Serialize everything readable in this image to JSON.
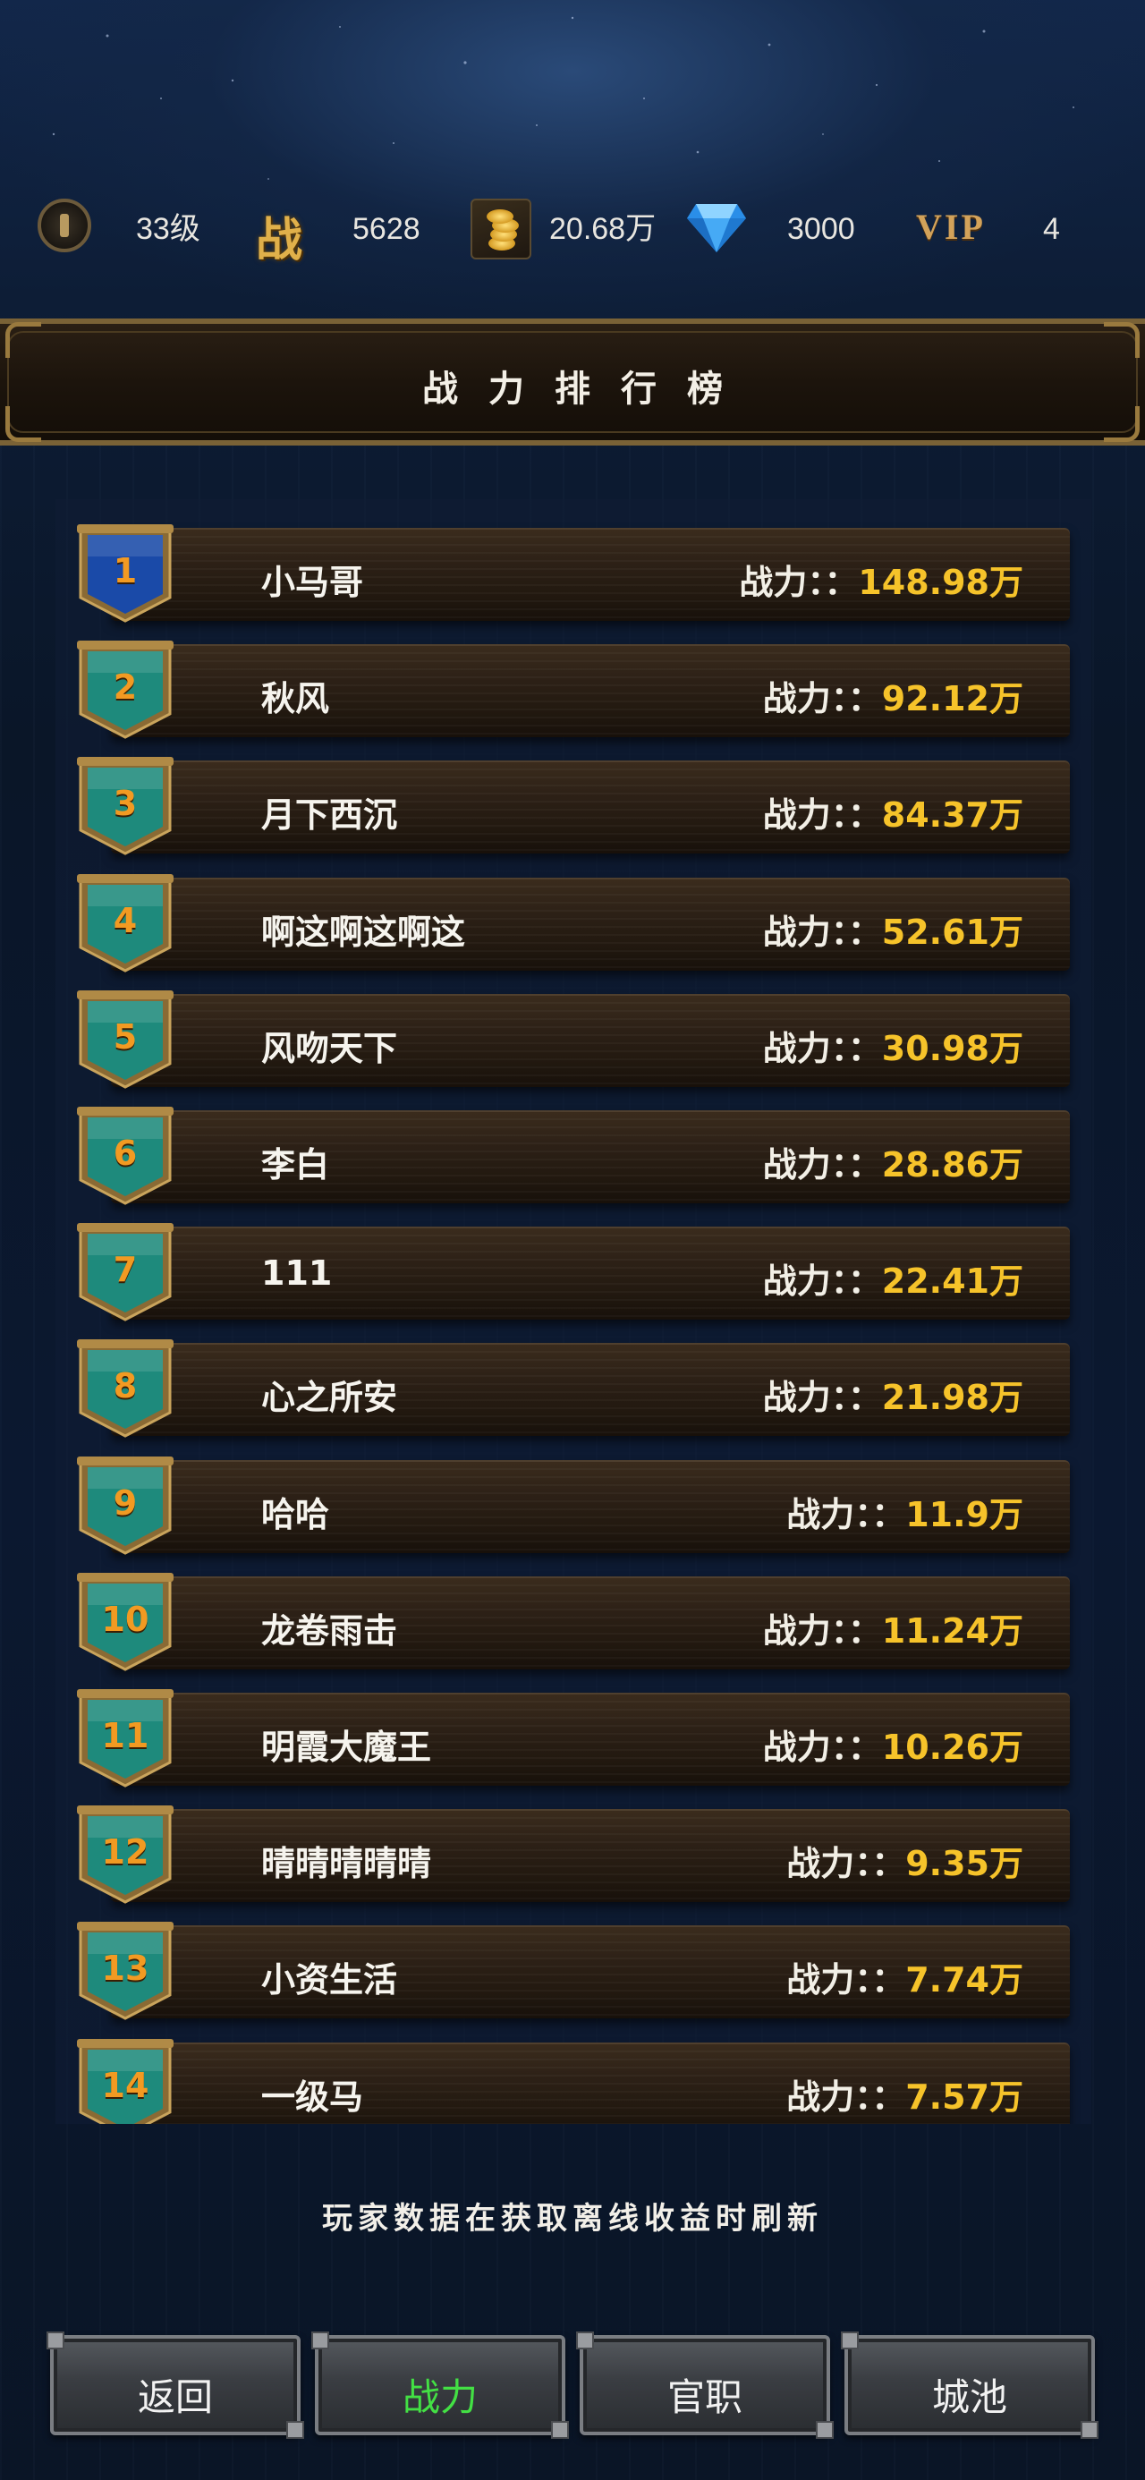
{
  "status_bar": {
    "level": "33级",
    "power_glyph": "战",
    "power": "5628",
    "gold": "20.68万",
    "gems": "3000",
    "vip_label": "VIP",
    "vip_level": "4"
  },
  "title": "战力排行榜",
  "rankings": [
    {
      "rank": "1",
      "name": "小马哥",
      "label": "战力：：",
      "value": "148.98万"
    },
    {
      "rank": "2",
      "name": "秋风",
      "label": "战力：：",
      "value": "92.12万"
    },
    {
      "rank": "3",
      "name": "月下西沉",
      "label": "战力：：",
      "value": "84.37万"
    },
    {
      "rank": "4",
      "name": "啊这啊这啊这",
      "label": "战力：：",
      "value": "52.61万"
    },
    {
      "rank": "5",
      "name": "风吻天下",
      "label": "战力：：",
      "value": "30.98万"
    },
    {
      "rank": "6",
      "name": "李白",
      "label": "战力：：",
      "value": "28.86万"
    },
    {
      "rank": "7",
      "name": "111",
      "label": "战力：：",
      "value": "22.41万"
    },
    {
      "rank": "8",
      "name": "心之所安",
      "label": "战力：：",
      "value": "21.98万"
    },
    {
      "rank": "9",
      "name": "哈哈",
      "label": "战力：：",
      "value": "11.9万"
    },
    {
      "rank": "10",
      "name": "龙卷雨击",
      "label": "战力：：",
      "value": "11.24万"
    },
    {
      "rank": "11",
      "name": "明霞大魔王",
      "label": "战力：：",
      "value": "10.26万"
    },
    {
      "rank": "12",
      "name": "晴晴晴晴晴",
      "label": "战力：：",
      "value": "9.35万"
    },
    {
      "rank": "13",
      "name": "小资生活",
      "label": "战力：：",
      "value": "7.74万"
    },
    {
      "rank": "14",
      "name": "一级马",
      "label": "战力：：",
      "value": "7.57万"
    }
  ],
  "footer_note": "玩家数据在获取离线收益时刷新",
  "buttons": {
    "back": "返回",
    "power": "战力",
    "official": "官职",
    "city": "城池"
  },
  "colors": {
    "value_gold": "#f6c32a",
    "rank_orange": "#f29a22",
    "active_green": "#43e044",
    "badge_first_blue": "#1a4aa8",
    "badge_teal": "#1e8a7c"
  }
}
